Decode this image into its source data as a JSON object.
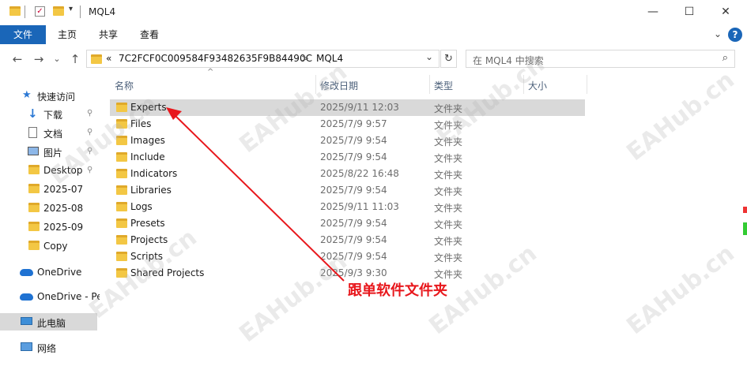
{
  "window": {
    "title": "MQL4",
    "minimize": "—",
    "maximize": "☐",
    "close": "✕"
  },
  "ribbon": {
    "tabs": [
      "文件",
      "主页",
      "共享",
      "查看"
    ],
    "expand": "⌄",
    "help": "?"
  },
  "nav": {
    "back": "←",
    "forward": "→",
    "recent": "⌄",
    "up": "↑",
    "path": [
      "«",
      "7C2FCF0C009584F93482635F9B84490C",
      ">",
      "MQL4"
    ],
    "dropdown": "⌄",
    "refresh": "↻"
  },
  "search": {
    "placeholder": "在 MQL4 中搜索",
    "icon": "search-icon"
  },
  "columns": {
    "name": "名称",
    "date": "修改日期",
    "type": "类型",
    "size": "大小",
    "sort": "^"
  },
  "sidebar": {
    "items": [
      {
        "label": "快速访问",
        "icon": "star-icon"
      },
      {
        "label": "下载",
        "icon": "download-icon",
        "pinned": true
      },
      {
        "label": "文档",
        "icon": "document-icon",
        "pinned": true
      },
      {
        "label": "图片",
        "icon": "picture-icon",
        "pinned": true
      },
      {
        "label": "Desktop",
        "icon": "folder-icon",
        "pinned": true
      },
      {
        "label": "2025-07",
        "icon": "folder-icon"
      },
      {
        "label": "2025-08",
        "icon": "folder-icon"
      },
      {
        "label": "2025-09",
        "icon": "folder-icon"
      },
      {
        "label": "Copy",
        "icon": "folder-icon"
      },
      {
        "label": "OneDrive",
        "icon": "cloud-icon"
      },
      {
        "label": "OneDrive - Pe",
        "icon": "cloud-icon"
      },
      {
        "label": "此电脑",
        "icon": "computer-icon",
        "selected": true
      },
      {
        "label": "网络",
        "icon": "network-icon"
      }
    ],
    "pin_glyph": "📌"
  },
  "files": [
    {
      "name": "Experts",
      "date": "2025/9/11 12:03",
      "type": "文件夹",
      "selected": true
    },
    {
      "name": "Files",
      "date": "2025/7/9 9:57",
      "type": "文件夹"
    },
    {
      "name": "Images",
      "date": "2025/7/9 9:54",
      "type": "文件夹"
    },
    {
      "name": "Include",
      "date": "2025/7/9 9:54",
      "type": "文件夹"
    },
    {
      "name": "Indicators",
      "date": "2025/8/22 16:48",
      "type": "文件夹"
    },
    {
      "name": "Libraries",
      "date": "2025/7/9 9:54",
      "type": "文件夹"
    },
    {
      "name": "Logs",
      "date": "2025/9/11 11:03",
      "type": "文件夹"
    },
    {
      "name": "Presets",
      "date": "2025/7/9 9:54",
      "type": "文件夹"
    },
    {
      "name": "Projects",
      "date": "2025/7/9 9:54",
      "type": "文件夹"
    },
    {
      "name": "Scripts",
      "date": "2025/7/9 9:54",
      "type": "文件夹"
    },
    {
      "name": "Shared Projects",
      "date": "2025/9/3 9:30",
      "type": "文件夹"
    }
  ],
  "annotation": {
    "text": "跟单软件文件夹",
    "color": "#e8171c"
  },
  "watermark": "EAHub.cn",
  "colors": {
    "accent": "#1a66b8",
    "selection": "#d9d9d9",
    "folder": "#f3c744"
  }
}
